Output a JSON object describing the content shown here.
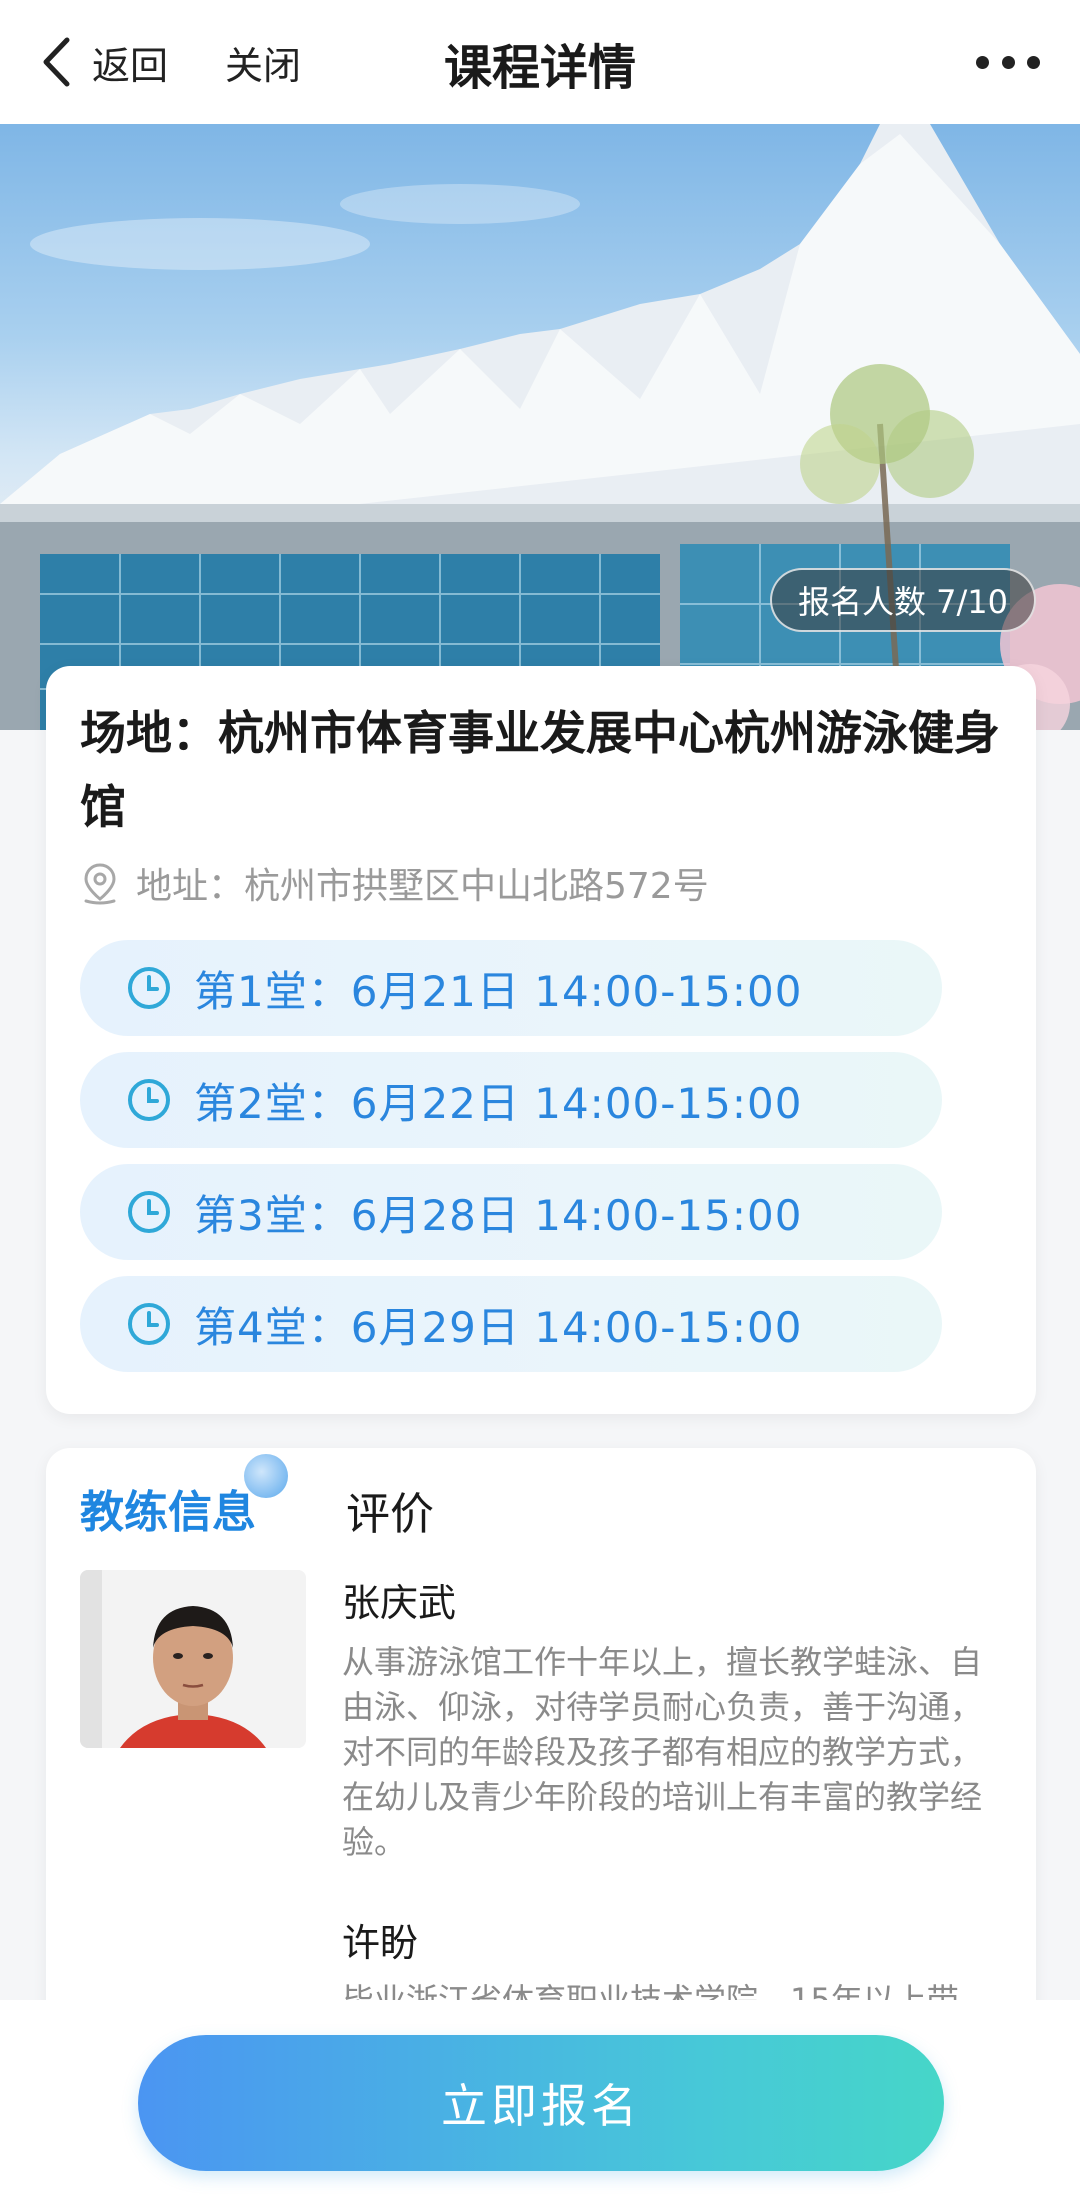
{
  "header": {
    "back_label": "返回",
    "close_label": "关闭",
    "title": "课程详情"
  },
  "hero": {
    "enroll_label": "报名人数 7/10"
  },
  "venue": {
    "title": "场地：杭州市体育事业发展中心杭州游泳健身馆",
    "address": "地址：杭州市拱墅区中山北路572号",
    "sessions": [
      "第1堂：6月21日 14:00-15:00",
      "第2堂：6月22日 14:00-15:00",
      "第3堂：6月28日 14:00-15:00",
      "第4堂：6月29日 14:00-15:00"
    ]
  },
  "coach_section": {
    "tabs": [
      "教练信息",
      "评价"
    ],
    "coaches": [
      {
        "name": "张庆武",
        "desc": "从事游泳馆工作十年以上，擅长教学蛙泳、自由泳、仰泳，对待学员耐心负责，善于沟通，对不同的年龄段及孩子都有相应的教学方式，在幼儿及青少年阶段的培训上有丰富的教学经验。"
      },
      {
        "name": "许盼",
        "desc": "毕业浙江省体育职业技术学院，15年以上带"
      }
    ]
  },
  "footer": {
    "signup_label": "立即报名"
  },
  "colors": {
    "accent_blue": "#2a86de",
    "button_gradient_start": "#4b95f2",
    "button_gradient_end": "#46d6c8"
  }
}
